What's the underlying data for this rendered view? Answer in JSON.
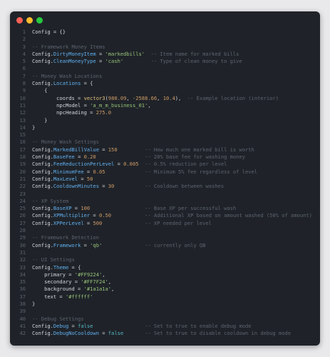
{
  "window": {
    "controls": [
      "close",
      "minimize",
      "maximize"
    ]
  },
  "colors": {
    "background": "#1f2329",
    "line_number": "#5c6370",
    "text": "#d4d7dd",
    "key": "#61afef",
    "string": "#98c379",
    "number": "#d19a66",
    "comment": "#5c6370",
    "boolean": "#56b6c2"
  },
  "code": {
    "lines": [
      {
        "n": "1",
        "t": "Config = {}"
      },
      {
        "n": "2",
        "t": ""
      },
      {
        "n": "3",
        "t": "-- Framework Money Items"
      },
      {
        "n": "4",
        "t": "Config.DirtyMoneyItem = 'markedbills'  -- Item name for marked bills"
      },
      {
        "n": "5",
        "t": "Config.CleanMoneyType = 'cash'         -- Type of clean money to give"
      },
      {
        "n": "6",
        "t": ""
      },
      {
        "n": "7",
        "t": "-- Money Wash Locations"
      },
      {
        "n": "8",
        "t": "Config.Locations = {"
      },
      {
        "n": "9",
        "t": "    {"
      },
      {
        "n": "10",
        "t": "        coords = vector3(980.09, -2588.66, 10.4),  -- Example location (interior)"
      },
      {
        "n": "11",
        "t": "        npcModel = 'a_m_m_business_01',"
      },
      {
        "n": "12",
        "t": "        npcHeading = 275.0"
      },
      {
        "n": "13",
        "t": "    }"
      },
      {
        "n": "14",
        "t": "}"
      },
      {
        "n": "15",
        "t": ""
      },
      {
        "n": "16",
        "t": "-- Money Wash Settings"
      },
      {
        "n": "17",
        "t": "Config.MarkedBillValue = 150         -- How much one marked bill is worth"
      },
      {
        "n": "18",
        "t": "Config.BaseFee = 0.20                -- 20% base fee for washing money"
      },
      {
        "n": "19",
        "t": "Config.FeeReductionPerLevel = 0.005  -- 0.5% reduction per level"
      },
      {
        "n": "20",
        "t": "Config.MinimumFee = 0.05             -- Minimum 5% fee regardless of level"
      },
      {
        "n": "21",
        "t": "Config.MaxLevel = 50"
      },
      {
        "n": "22",
        "t": "Config.CooldownMinutes = 30          -- Cooldown between washes"
      },
      {
        "n": "23",
        "t": ""
      },
      {
        "n": "24",
        "t": "-- XP System"
      },
      {
        "n": "25",
        "t": "Config.BaseXP = 100                  -- Base XP per successful wash"
      },
      {
        "n": "26",
        "t": "Config.XPMultiplier = 0.50           -- Additional XP based on amount washed (50% of amount)"
      },
      {
        "n": "27",
        "t": "Config.XPPerLevel = 500              -- XP needed per level"
      },
      {
        "n": "28",
        "t": ""
      },
      {
        "n": "29",
        "t": "-- Framework Detection"
      },
      {
        "n": "30",
        "t": "Config.Framework = 'qb'              -- currently only QB"
      },
      {
        "n": "31",
        "t": ""
      },
      {
        "n": "32",
        "t": "-- UI Settings"
      },
      {
        "n": "33",
        "t": "Config.Theme = {"
      },
      {
        "n": "34",
        "t": "    primary = '#FF9224',"
      },
      {
        "n": "35",
        "t": "    secondary = '#FF7F24',"
      },
      {
        "n": "36",
        "t": "    background = '#1a1a1a',"
      },
      {
        "n": "37",
        "t": "    text = '#ffffff'"
      },
      {
        "n": "38",
        "t": "}"
      },
      {
        "n": "39",
        "t": ""
      },
      {
        "n": "40",
        "t": "-- Debug Settings"
      },
      {
        "n": "41",
        "t": "Config.Debug = false                 -- Set to true to enable debug mode"
      },
      {
        "n": "42",
        "t": "Config.DebugNoCooldown = false       -- Set to true to disable cooldown in debug mode"
      }
    ]
  }
}
